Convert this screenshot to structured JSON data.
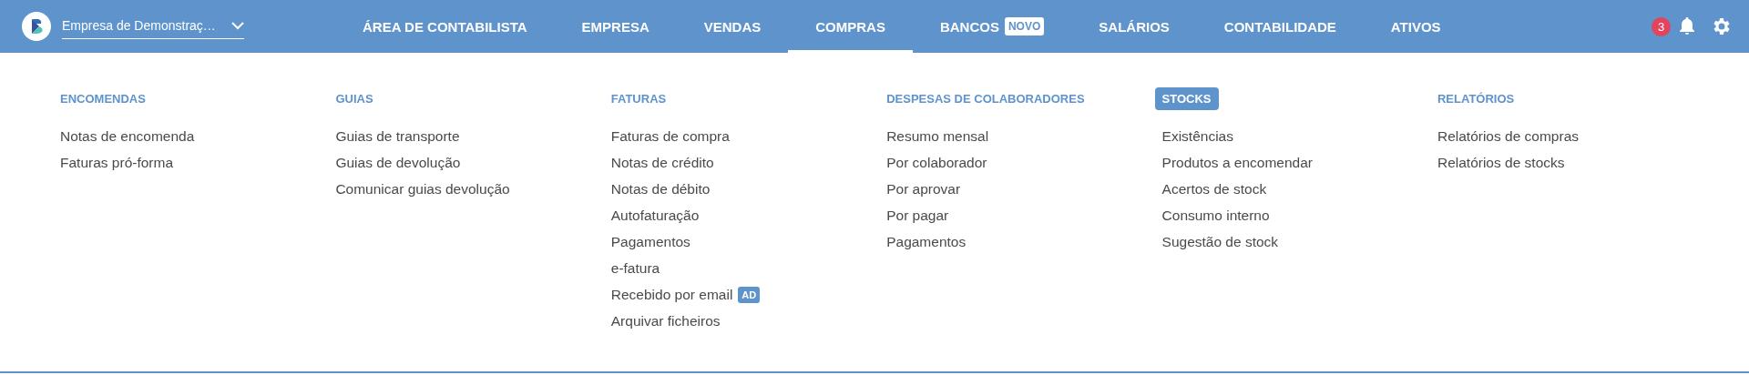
{
  "company_selector": {
    "value": "Empresa de Demonstraç…"
  },
  "nav": [
    {
      "label": "ÁREA DE CONTABILISTA",
      "selected": false
    },
    {
      "label": "EMPRESA",
      "selected": false
    },
    {
      "label": "VENDAS",
      "selected": false
    },
    {
      "label": "COMPRAS",
      "selected": true
    },
    {
      "label": "BANCOS",
      "selected": false,
      "badge": "NOVO"
    },
    {
      "label": "SALÁRIOS",
      "selected": false
    },
    {
      "label": "CONTABILIDADE",
      "selected": false
    },
    {
      "label": "ATIVOS",
      "selected": false
    }
  ],
  "notifications": {
    "count": "3"
  },
  "menu": [
    {
      "title": "ENCOMENDAS",
      "selected": false,
      "items": [
        {
          "label": "Notas de encomenda"
        },
        {
          "label": "Faturas pró-forma"
        }
      ]
    },
    {
      "title": "GUIAS",
      "selected": false,
      "items": [
        {
          "label": "Guias de transporte"
        },
        {
          "label": "Guias de devolução"
        },
        {
          "label": "Comunicar guias devolução"
        }
      ]
    },
    {
      "title": "FATURAS",
      "selected": false,
      "items": [
        {
          "label": "Faturas de compra"
        },
        {
          "label": "Notas de crédito"
        },
        {
          "label": "Notas de débito"
        },
        {
          "label": "Autofaturação"
        },
        {
          "label": "Pagamentos"
        },
        {
          "label": "e-fatura"
        },
        {
          "label": "Recebido por email",
          "badge": "AD"
        },
        {
          "label": "Arquivar ficheiros"
        }
      ]
    },
    {
      "title": "DESPESAS DE COLABORADORES",
      "selected": false,
      "items": [
        {
          "label": "Resumo mensal"
        },
        {
          "label": "Por colaborador"
        },
        {
          "label": "Por aprovar"
        },
        {
          "label": "Por pagar"
        },
        {
          "label": "Pagamentos"
        }
      ]
    },
    {
      "title": "STOCKS",
      "selected": true,
      "items": [
        {
          "label": "Existências"
        },
        {
          "label": "Produtos a encomendar"
        },
        {
          "label": "Acertos de stock"
        },
        {
          "label": "Consumo interno"
        },
        {
          "label": "Sugestão de stock"
        }
      ]
    },
    {
      "title": "RELATÓRIOS",
      "selected": false,
      "items": [
        {
          "label": "Relatórios de compras"
        },
        {
          "label": "Relatórios de stocks"
        }
      ]
    }
  ]
}
